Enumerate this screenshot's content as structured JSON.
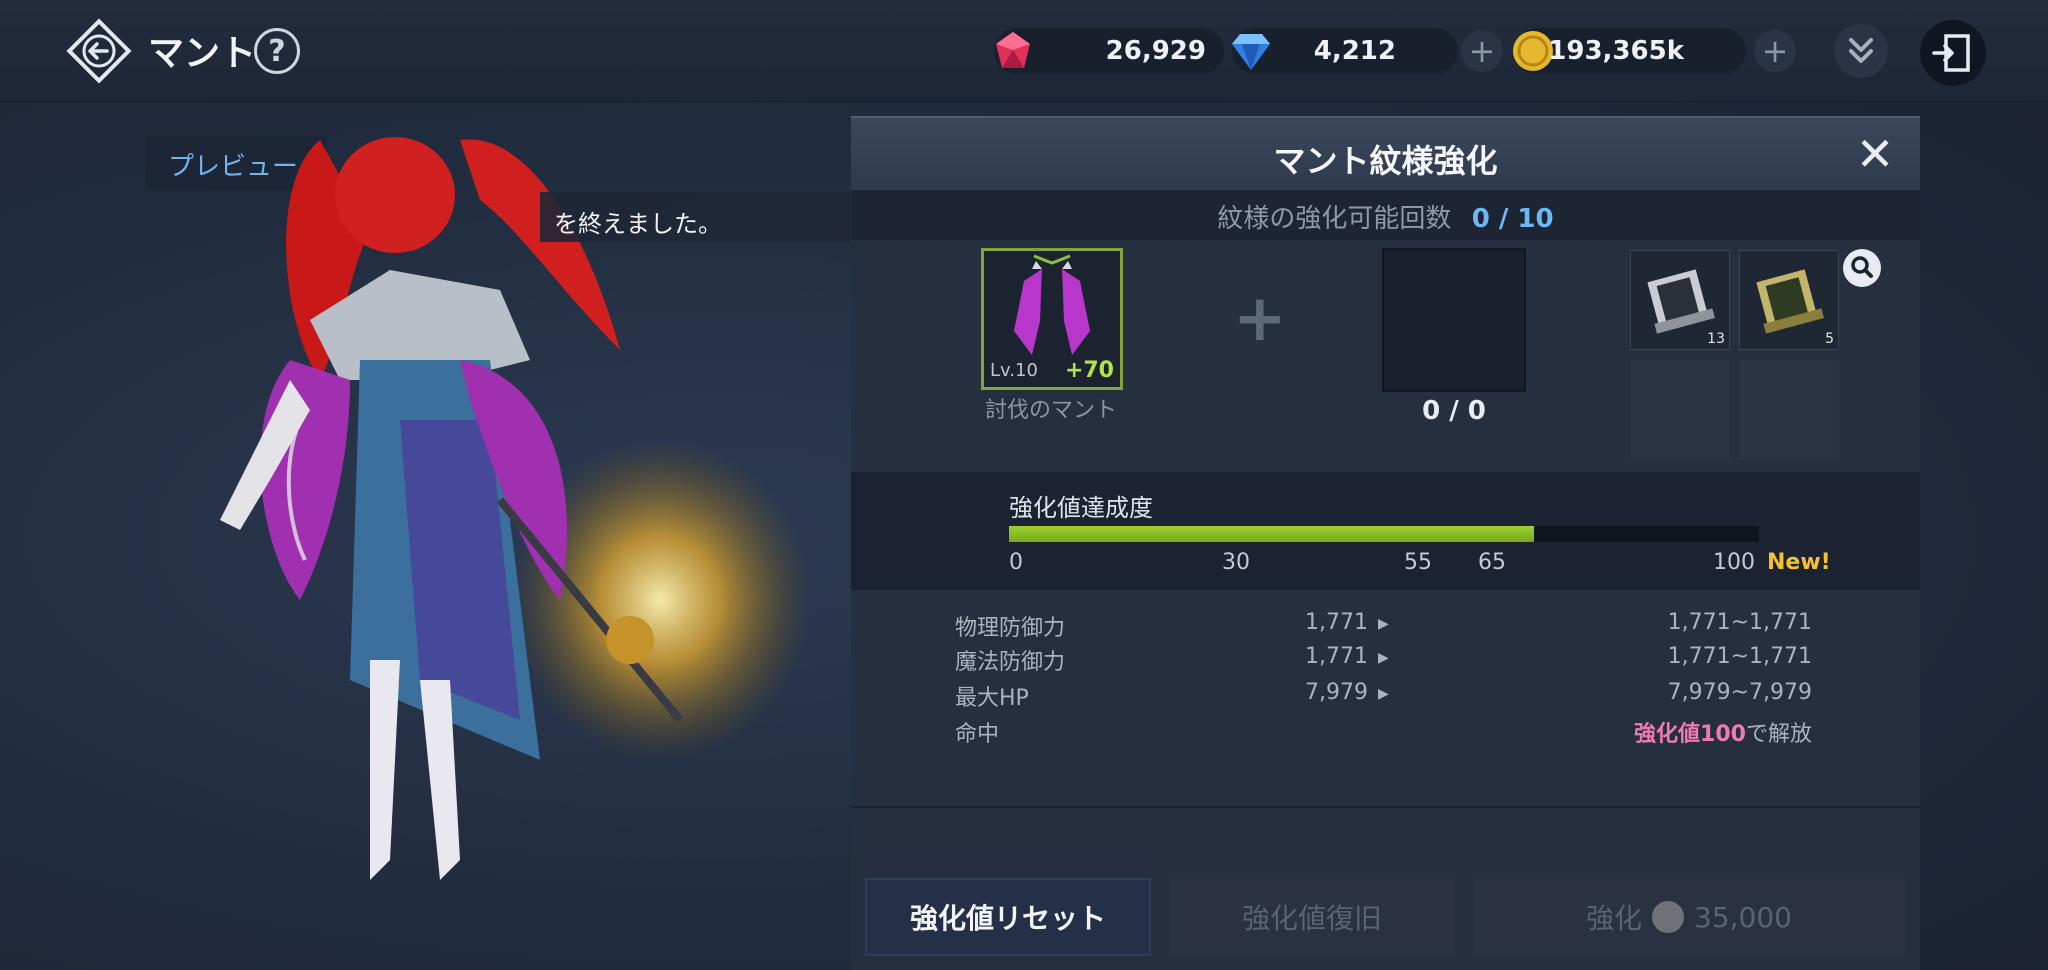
{
  "header": {
    "title": "マント",
    "help_label": "?"
  },
  "currencies": [
    {
      "name": "ruby",
      "amount": "26,929",
      "color": "#e0305a"
    },
    {
      "name": "diamond",
      "amount": "4,212",
      "color": "#3a8af0"
    },
    {
      "name": "gold",
      "amount": "193,365k",
      "color": "#e5b830"
    }
  ],
  "preview": {
    "tab_label": "プレビュー",
    "notice": "を終えました。"
  },
  "panel": {
    "title": "マント紋様強化",
    "count_label": "紋様の強化可能回数",
    "count_value": "0 / 10",
    "item": {
      "level": "Lv.10",
      "plus": "+70",
      "name": "討伐のマント"
    },
    "material_count": "0 / 0",
    "scrolls": [
      {
        "count": "13"
      },
      {
        "count": "5"
      }
    ],
    "progress": {
      "label": "強化値達成度",
      "value": 70,
      "max": 100,
      "ticks": [
        "0",
        "30",
        "55",
        "65",
        "100"
      ],
      "new_label": "New!"
    },
    "stats": [
      {
        "name": "物理防御力",
        "current": "1,771",
        "range": "1,771~1,771"
      },
      {
        "name": "魔法防御力",
        "current": "1,771",
        "range": "1,771~1,771"
      },
      {
        "name": "最大HP",
        "current": "7,979",
        "range": "7,979~7,979"
      },
      {
        "name": "命中",
        "current": "",
        "range": "",
        "unlock_value": "強化値100",
        "unlock_suffix": "で解放"
      }
    ],
    "buttons": {
      "reset": "強化値リセット",
      "restore": "強化値復旧",
      "enhance": "強化",
      "enhance_cost": "35,000"
    }
  }
}
